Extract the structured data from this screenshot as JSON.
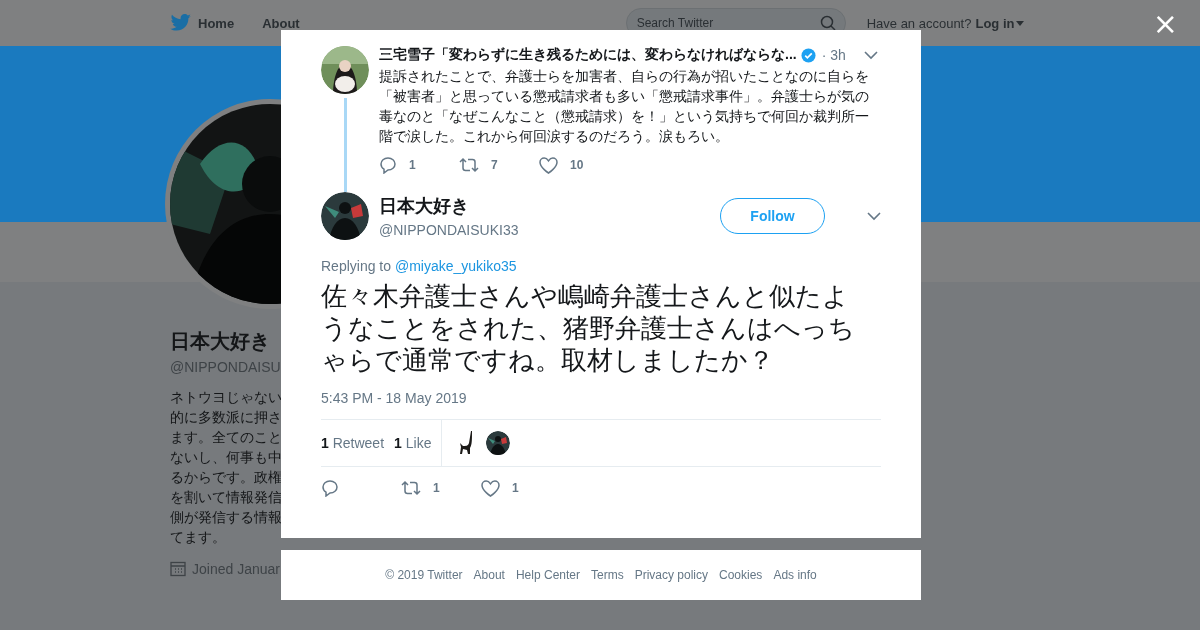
{
  "top_nav": {
    "items": [
      {
        "label": "Home"
      },
      {
        "label": "About"
      }
    ],
    "search": {
      "placeholder": "Search Twitter"
    },
    "account_prompt": "Have an account?",
    "login": "Log in"
  },
  "profile": {
    "name": "日本大好き",
    "handle": "@NIPPONDAISU",
    "bio_lines": [
      "ネトウヨじゃない",
      "的に多数派に押さ",
      "ます。全てのこと",
      "ないし、何事も中",
      "るからです。政権",
      "を割いて情報発信",
      "側が発信する情報",
      "てます。"
    ],
    "joined": "Joined Januar"
  },
  "modal": {
    "close": "×",
    "parent_tweet": {
      "name": "三宅雪子「変わらずに生き残るためには、変わらなければならな...",
      "verified": true,
      "time": "· 3h",
      "text": "提訴されたことで、弁護士らを加害者、自らの行為が招いたことなのに自らを「被害者」と思っている懲戒請求者も多い「懲戒請求事件」。弁護士らが気の毒なのと「なぜこんなこと（懲戒請求）を！」という気持ちで何回か裁判所一階で涙した。これから何回涙するのだろう。涙もろい。",
      "actions": [
        {
          "kind": "reply",
          "count": "1"
        },
        {
          "kind": "retweet",
          "count": "7"
        },
        {
          "kind": "like",
          "count": "10"
        }
      ]
    },
    "tweet": {
      "name": "日本大好き",
      "handle": "@NIPPONDAISUKI33",
      "follow_button": "Follow",
      "replying_to": "Replying to",
      "mention": "@miyake_yukiko35",
      "text": "佐々木弁護士さんや嶋崎弁護士さんと似たようなことをされた、猪野弁護士さんはへっちゃらで通常ですね。取材しましたか？",
      "timestamp": "5:43 PM - 18 May 2019",
      "stats": [
        {
          "count": "1",
          "label": "Retweet"
        },
        {
          "count": "1",
          "label": "Like"
        }
      ],
      "actions": [
        {
          "kind": "reply"
        },
        {
          "kind": "retweet",
          "count": "1"
        },
        {
          "kind": "like",
          "count": "1"
        }
      ]
    }
  },
  "footer": {
    "links": [
      "© 2019 Twitter",
      "About",
      "Help Center",
      "Terms",
      "Privacy policy",
      "Cookies",
      "Ads info"
    ]
  }
}
